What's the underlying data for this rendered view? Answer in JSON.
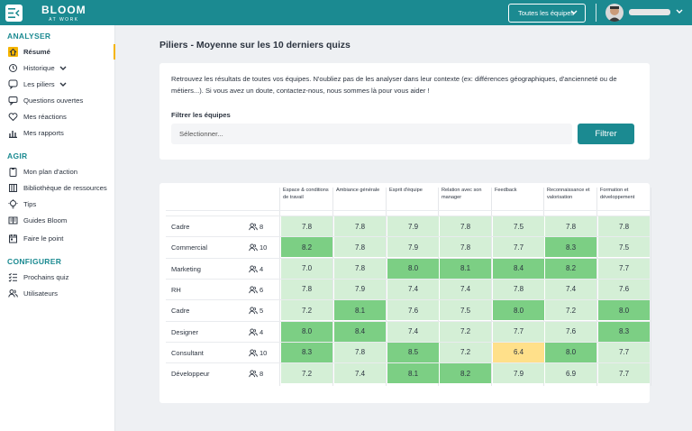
{
  "header": {
    "logo_text": "BLOOM",
    "logo_sub": "AT WORK",
    "team_select": "Toutes les équipes"
  },
  "sidebar": {
    "sections": [
      {
        "label": "ANALYSER",
        "items": [
          {
            "label": "Résumé",
            "icon": "home-icon",
            "active": true
          },
          {
            "label": "Historique",
            "icon": "history-icon",
            "chevron": true
          },
          {
            "label": "Les piliers",
            "icon": "pillars-icon",
            "chevron": true
          },
          {
            "label": "Questions ouvertes",
            "icon": "chat-icon"
          },
          {
            "label": "Mes réactions",
            "icon": "heart-icon"
          },
          {
            "label": "Mes rapports",
            "icon": "bar-chart-icon"
          }
        ]
      },
      {
        "label": "AGIR",
        "items": [
          {
            "label": "Mon plan d'action",
            "icon": "clipboard-icon"
          },
          {
            "label": "Bibliothèque de ressources",
            "icon": "library-icon"
          },
          {
            "label": "Tips",
            "icon": "lightbulb-icon"
          },
          {
            "label": "Guides Bloom",
            "icon": "book-icon"
          },
          {
            "label": "Faire le point",
            "icon": "calendar-icon"
          }
        ]
      },
      {
        "label": "CONFIGURER",
        "items": [
          {
            "label": "Prochains quiz",
            "icon": "list-icon"
          },
          {
            "label": "Utilisateurs",
            "icon": "users-icon"
          }
        ]
      }
    ]
  },
  "main": {
    "title": "Piliers - Moyenne sur les 10 derniers quizs",
    "description": "Retrouvez les résultats de toutes vos équipes. N'oubliez pas de les analyser dans leur contexte (ex: différences géographiques, d'ancienneté ou de métiers...). Si vous avez un doute, contactez-nous, nous sommes là pour vous aider !",
    "filter_label": "Filtrer les équipes",
    "filter_placeholder": "Sélectionner...",
    "filter_button": "Filtrer"
  },
  "colors": {
    "accent": "#1b8a91",
    "active": "#f5b400",
    "high": "#7ccf84",
    "mid": "#d4efd6",
    "low": "#ffe08a"
  },
  "table": {
    "columns": [
      "Espace & conditions de travail",
      "Ambiance générale",
      "Esprit d'équipe",
      "Relation avec son manager",
      "Feedback",
      "Reconnaissance et valorisation",
      "Formation et développement"
    ],
    "rows": [
      {
        "team": "Cadre",
        "count": "8",
        "values": [
          "7.8",
          "7.8",
          "7.9",
          "7.8",
          "7.5",
          "7.8",
          "7.8"
        ],
        "levels": [
          "m",
          "m",
          "m",
          "m",
          "m",
          "m",
          "m"
        ]
      },
      {
        "team": "Commercial",
        "count": "10",
        "values": [
          "8.2",
          "7.8",
          "7.9",
          "7.8",
          "7.7",
          "8.3",
          "7.5"
        ],
        "levels": [
          "h",
          "m",
          "m",
          "m",
          "m",
          "h",
          "m"
        ]
      },
      {
        "team": "Marketing",
        "count": "4",
        "values": [
          "7.0",
          "7.8",
          "8.0",
          "8.1",
          "8.4",
          "8.2",
          "7.7"
        ],
        "levels": [
          "m",
          "m",
          "h",
          "h",
          "h",
          "h",
          "m"
        ]
      },
      {
        "team": "RH",
        "count": "6",
        "values": [
          "7.8",
          "7.9",
          "7.4",
          "7.4",
          "7.8",
          "7.4",
          "7.6"
        ],
        "levels": [
          "m",
          "m",
          "m",
          "m",
          "m",
          "m",
          "m"
        ]
      },
      {
        "team": "Cadre",
        "count": "5",
        "values": [
          "7.2",
          "8.1",
          "7.6",
          "7.5",
          "8.0",
          "7.2",
          "8.0"
        ],
        "levels": [
          "m",
          "h",
          "m",
          "m",
          "h",
          "m",
          "h"
        ]
      },
      {
        "team": "Designer",
        "count": "4",
        "values": [
          "8.0",
          "8.4",
          "7.4",
          "7.2",
          "7.7",
          "7.6",
          "8.3"
        ],
        "levels": [
          "h",
          "h",
          "m",
          "m",
          "m",
          "m",
          "h"
        ]
      },
      {
        "team": "Consultant",
        "count": "10",
        "values": [
          "8.3",
          "7.8",
          "8.5",
          "7.2",
          "6.4",
          "8.0",
          "7.7"
        ],
        "levels": [
          "h",
          "m",
          "h",
          "m",
          "l",
          "h",
          "m"
        ]
      },
      {
        "team": "Développeur",
        "count": "8",
        "values": [
          "7.2",
          "7.4",
          "8.1",
          "8.2",
          "7.9",
          "6.9",
          "7.7"
        ],
        "levels": [
          "m",
          "m",
          "h",
          "h",
          "m",
          "m",
          "m"
        ]
      }
    ]
  }
}
